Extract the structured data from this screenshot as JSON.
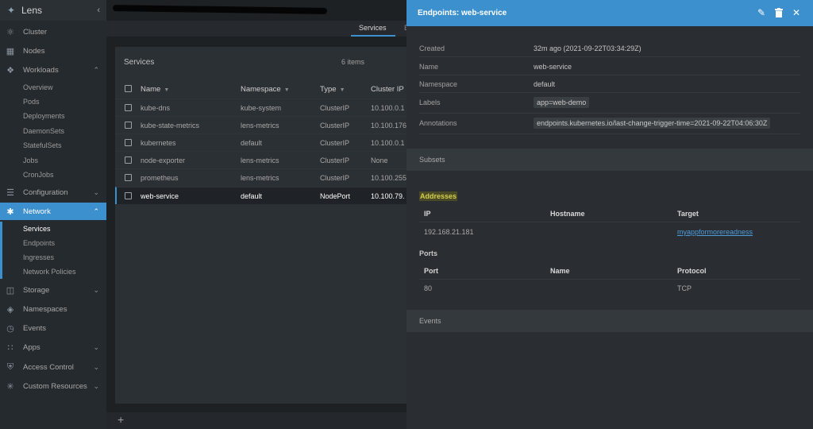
{
  "app": {
    "title": "Lens"
  },
  "sidebar": {
    "items": [
      {
        "label": "Cluster",
        "icon": "cluster-icon"
      },
      {
        "label": "Nodes",
        "icon": "nodes-icon"
      },
      {
        "label": "Workloads",
        "icon": "workloads-icon"
      },
      {
        "label": "Configuration",
        "icon": "configuration-icon"
      },
      {
        "label": "Network",
        "icon": "network-icon"
      },
      {
        "label": "Storage",
        "icon": "storage-icon"
      },
      {
        "label": "Namespaces",
        "icon": "namespaces-icon"
      },
      {
        "label": "Events",
        "icon": "events-icon"
      },
      {
        "label": "Apps",
        "icon": "apps-icon"
      },
      {
        "label": "Access Control",
        "icon": "shield-icon"
      },
      {
        "label": "Custom Resources",
        "icon": "puzzle-icon"
      }
    ],
    "workloads_sub": [
      "Overview",
      "Pods",
      "Deployments",
      "DaemonSets",
      "StatefulSets",
      "Jobs",
      "CronJobs"
    ],
    "network_sub": [
      "Services",
      "Endpoints",
      "Ingresses",
      "Network Policies"
    ]
  },
  "tabs": {
    "active": "Services",
    "next": "E"
  },
  "services": {
    "title": "Services",
    "count": "6 items",
    "columns": [
      "Name",
      "Namespace",
      "Type",
      "Cluster IP"
    ],
    "rows": [
      [
        "kube-dns",
        "kube-system",
        "ClusterIP",
        "10.100.0.1"
      ],
      [
        "kube-state-metrics",
        "lens-metrics",
        "ClusterIP",
        "10.100.176"
      ],
      [
        "kubernetes",
        "default",
        "ClusterIP",
        "10.100.0.1"
      ],
      [
        "node-exporter",
        "lens-metrics",
        "ClusterIP",
        "None"
      ],
      [
        "prometheus",
        "lens-metrics",
        "ClusterIP",
        "10.100.255"
      ],
      [
        "web-service",
        "default",
        "NodePort",
        "10.100.79."
      ]
    ]
  },
  "drawer": {
    "title": "Endpoints: web-service",
    "details": [
      {
        "label": "Created",
        "value": "32m ago (2021-09-22T03:34:29Z)"
      },
      {
        "label": "Name",
        "value": "web-service"
      },
      {
        "label": "Namespace",
        "value": "default"
      },
      {
        "label": "Labels",
        "value": "app=web-demo"
      },
      {
        "label": "Annotations",
        "value": "endpoints.kubernetes.io/last-change-trigger-time=2021-09-22T04:06:30Z"
      }
    ],
    "subsets_title": "Subsets",
    "addresses_title": "Addresses",
    "addresses_columns": [
      "IP",
      "Hostname",
      "Target"
    ],
    "addresses_rows": [
      [
        "192.168.21.181",
        "",
        "myappformorereadness"
      ]
    ],
    "ports_title": "Ports",
    "ports_columns": [
      "Port",
      "Name",
      "Protocol"
    ],
    "ports_rows": [
      [
        "80",
        "",
        "TCP"
      ]
    ],
    "events_title": "Events"
  },
  "colors": {
    "accent": "#3d90ce",
    "sidebar_bg": "#252a2e",
    "drawer_bg": "#2a2e33"
  }
}
